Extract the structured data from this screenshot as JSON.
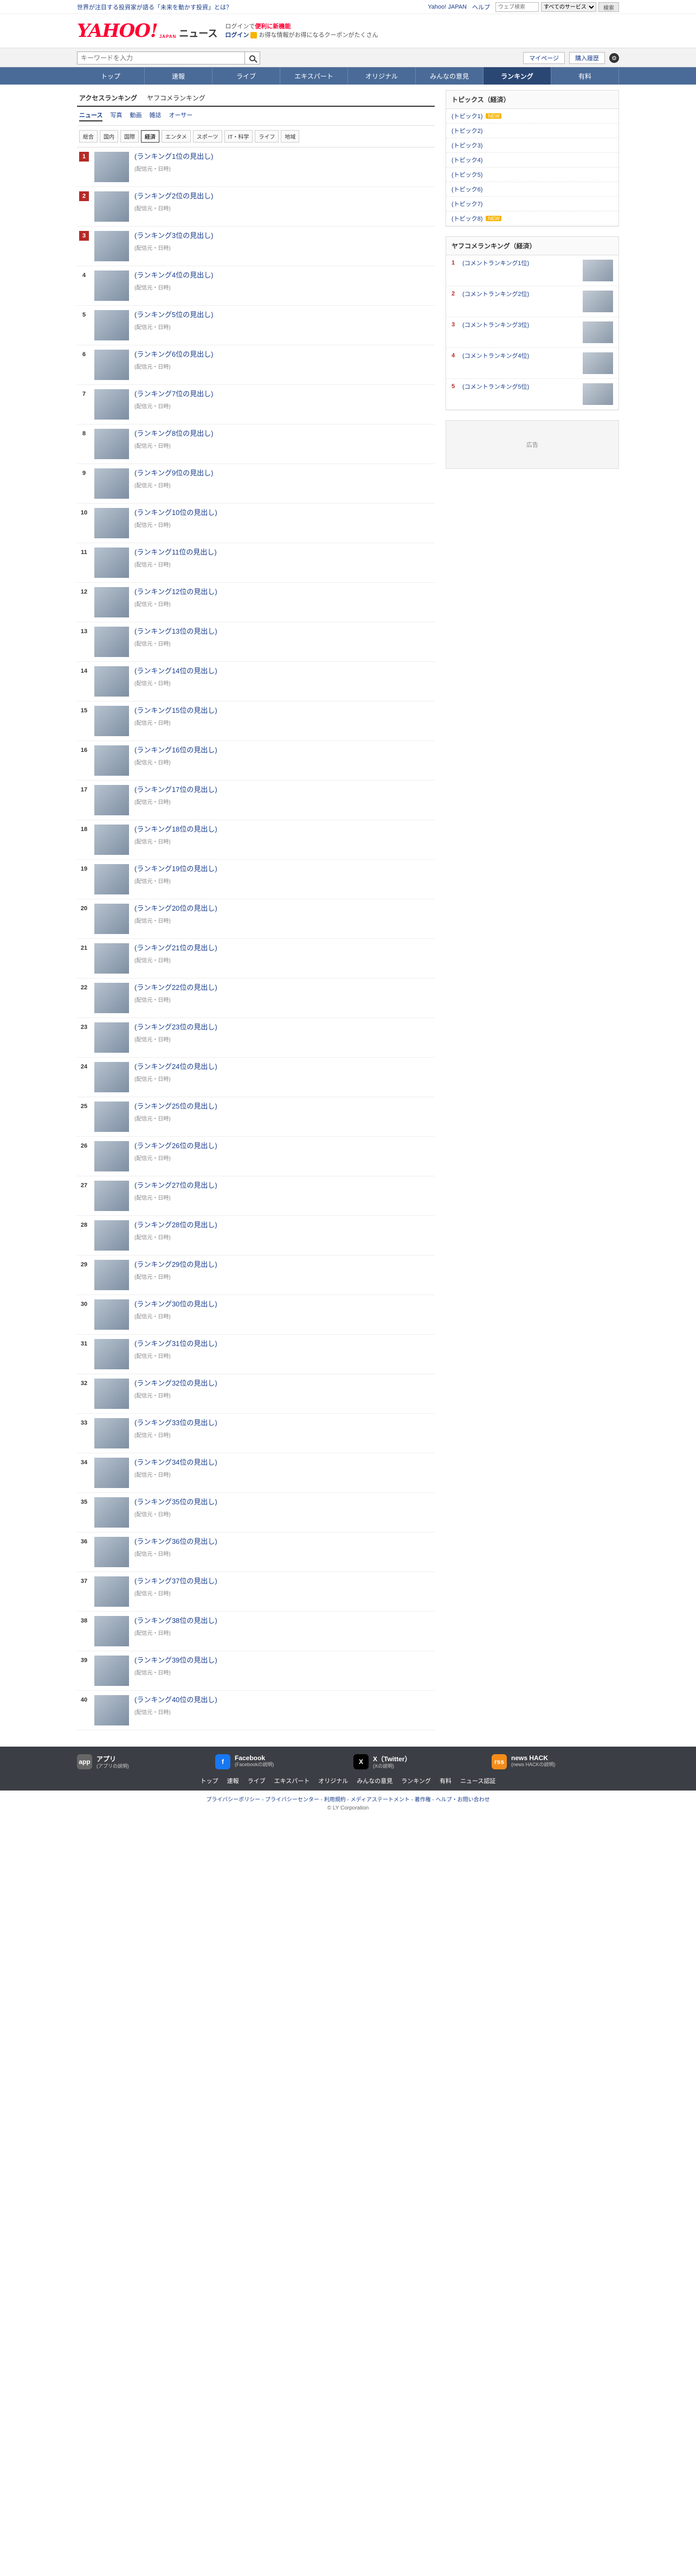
{
  "promo": {
    "left": "世界が注目する投資家が語る「未来を動かす投資」とは？",
    "yahoo_link": "Yahoo! JAPAN",
    "help_link": "ヘルプ",
    "search_placeholder": "ウェブ検索",
    "search_scope": "すべてのサービス",
    "search_button": "検索"
  },
  "brand": {
    "logo_yahoo": "YAHOO!",
    "logo_japan": "JAPAN",
    "logo_news": "ニュース",
    "tagline_prefix": "ログインで",
    "tagline_highlight": "便利に新機能",
    "login": "ログイン",
    "coupon_text": "お得な情報がお得になるクーポンがたくさん"
  },
  "searchbar": {
    "placeholder": "キーワードを入力",
    "mypage": "マイページ",
    "subscribe": "購入履歴"
  },
  "gnav": [
    {
      "label": "トップ"
    },
    {
      "label": "速報"
    },
    {
      "label": "ライブ"
    },
    {
      "label": "エキスパート"
    },
    {
      "label": "オリジナル"
    },
    {
      "label": "みんなの意見"
    },
    {
      "label": "ランキング",
      "active": true
    },
    {
      "label": "有料"
    }
  ],
  "subtabs": [
    {
      "label": "アクセスランキング",
      "on": true
    },
    {
      "label": "ヤフコメランキング"
    }
  ],
  "kindtabs": [
    {
      "label": "ニュース",
      "on": true
    },
    {
      "label": "写真"
    },
    {
      "label": "動画"
    },
    {
      "label": "雑誌"
    },
    {
      "label": "オーサー"
    }
  ],
  "cattabs": [
    {
      "label": "総合"
    },
    {
      "label": "国内"
    },
    {
      "label": "国際"
    },
    {
      "label": "経済",
      "on": true
    },
    {
      "label": "エンタメ"
    },
    {
      "label": "スポーツ"
    },
    {
      "label": "IT・科学"
    },
    {
      "label": "ライフ"
    },
    {
      "label": "地域"
    }
  ],
  "ranking": [
    {
      "no": "1",
      "title": "(ランキング1位の見出し)",
      "meta": "(配信元・日時)"
    },
    {
      "no": "2",
      "title": "(ランキング2位の見出し)",
      "meta": "(配信元・日時)"
    },
    {
      "no": "3",
      "title": "(ランキング3位の見出し)",
      "meta": "(配信元・日時)"
    },
    {
      "no": "4",
      "title": "(ランキング4位の見出し)",
      "meta": "(配信元・日時)"
    },
    {
      "no": "5",
      "title": "(ランキング5位の見出し)",
      "meta": "(配信元・日時)"
    },
    {
      "no": "6",
      "title": "(ランキング6位の見出し)",
      "meta": "(配信元・日時)"
    },
    {
      "no": "7",
      "title": "(ランキング7位の見出し)",
      "meta": "(配信元・日時)"
    },
    {
      "no": "8",
      "title": "(ランキング8位の見出し)",
      "meta": "(配信元・日時)"
    },
    {
      "no": "9",
      "title": "(ランキング9位の見出し)",
      "meta": "(配信元・日時)"
    },
    {
      "no": "10",
      "title": "(ランキング10位の見出し)",
      "meta": "(配信元・日時)"
    },
    {
      "no": "11",
      "title": "(ランキング11位の見出し)",
      "meta": "(配信元・日時)"
    },
    {
      "no": "12",
      "title": "(ランキング12位の見出し)",
      "meta": "(配信元・日時)"
    },
    {
      "no": "13",
      "title": "(ランキング13位の見出し)",
      "meta": "(配信元・日時)"
    },
    {
      "no": "14",
      "title": "(ランキング14位の見出し)",
      "meta": "(配信元・日時)"
    },
    {
      "no": "15",
      "title": "(ランキング15位の見出し)",
      "meta": "(配信元・日時)"
    },
    {
      "no": "16",
      "title": "(ランキング16位の見出し)",
      "meta": "(配信元・日時)"
    },
    {
      "no": "17",
      "title": "(ランキング17位の見出し)",
      "meta": "(配信元・日時)"
    },
    {
      "no": "18",
      "title": "(ランキング18位の見出し)",
      "meta": "(配信元・日時)"
    },
    {
      "no": "19",
      "title": "(ランキング19位の見出し)",
      "meta": "(配信元・日時)"
    },
    {
      "no": "20",
      "title": "(ランキング20位の見出し)",
      "meta": "(配信元・日時)"
    },
    {
      "no": "21",
      "title": "(ランキング21位の見出し)",
      "meta": "(配信元・日時)"
    },
    {
      "no": "22",
      "title": "(ランキング22位の見出し)",
      "meta": "(配信元・日時)"
    },
    {
      "no": "23",
      "title": "(ランキング23位の見出し)",
      "meta": "(配信元・日時)"
    },
    {
      "no": "24",
      "title": "(ランキング24位の見出し)",
      "meta": "(配信元・日時)"
    },
    {
      "no": "25",
      "title": "(ランキング25位の見出し)",
      "meta": "(配信元・日時)"
    },
    {
      "no": "26",
      "title": "(ランキング26位の見出し)",
      "meta": "(配信元・日時)"
    },
    {
      "no": "27",
      "title": "(ランキング27位の見出し)",
      "meta": "(配信元・日時)"
    },
    {
      "no": "28",
      "title": "(ランキング28位の見出し)",
      "meta": "(配信元・日時)"
    },
    {
      "no": "29",
      "title": "(ランキング29位の見出し)",
      "meta": "(配信元・日時)"
    },
    {
      "no": "30",
      "title": "(ランキング30位の見出し)",
      "meta": "(配信元・日時)"
    },
    {
      "no": "31",
      "title": "(ランキング31位の見出し)",
      "meta": "(配信元・日時)"
    },
    {
      "no": "32",
      "title": "(ランキング32位の見出し)",
      "meta": "(配信元・日時)"
    },
    {
      "no": "33",
      "title": "(ランキング33位の見出し)",
      "meta": "(配信元・日時)"
    },
    {
      "no": "34",
      "title": "(ランキング34位の見出し)",
      "meta": "(配信元・日時)"
    },
    {
      "no": "35",
      "title": "(ランキング35位の見出し)",
      "meta": "(配信元・日時)"
    },
    {
      "no": "36",
      "title": "(ランキング36位の見出し)",
      "meta": "(配信元・日時)"
    },
    {
      "no": "37",
      "title": "(ランキング37位の見出し)",
      "meta": "(配信元・日時)"
    },
    {
      "no": "38",
      "title": "(ランキング38位の見出し)",
      "meta": "(配信元・日時)"
    },
    {
      "no": "39",
      "title": "(ランキング39位の見出し)",
      "meta": "(配信元・日時)"
    },
    {
      "no": "40",
      "title": "(ランキング40位の見出し)",
      "meta": "(配信元・日時)"
    }
  ],
  "side": {
    "topics_head": "トピックス（経済）",
    "topics": [
      {
        "label": "(トピック1)",
        "badge": "NEW"
      },
      {
        "label": "(トピック2)"
      },
      {
        "label": "(トピック3)"
      },
      {
        "label": "(トピック4)"
      },
      {
        "label": "(トピック5)"
      },
      {
        "label": "(トピック6)"
      },
      {
        "label": "(トピック7)"
      },
      {
        "label": "(トピック8)",
        "badge": "NEW"
      }
    ],
    "comment_head": "ヤフコメランキング（経済）",
    "comment_rank": [
      {
        "no": "1",
        "title": "(コメントランキング1位)"
      },
      {
        "no": "2",
        "title": "(コメントランキング2位)"
      },
      {
        "no": "3",
        "title": "(コメントランキング3位)"
      },
      {
        "no": "4",
        "title": "(コメントランキング4位)"
      },
      {
        "no": "5",
        "title": "(コメントランキング5位)"
      }
    ],
    "ad_label": "広告"
  },
  "footer": {
    "apps": [
      {
        "icon": "app",
        "name": "アプリ",
        "desc": "(アプリの説明)"
      },
      {
        "icon": "f",
        "name": "Facebook",
        "desc": "(Facebookの説明)"
      },
      {
        "icon": "X",
        "name": "X（Twitter）",
        "desc": "(Xの説明)"
      },
      {
        "icon": "rss",
        "name": "news HACK",
        "desc": "(news HACKの説明)"
      }
    ],
    "nav": [
      "トップ",
      "速報",
      "ライブ",
      "エキスパート",
      "オリジナル",
      "みんなの意見",
      "ランキング",
      "有料",
      "ニュース認証"
    ],
    "links": "プライバシーポリシー - プライバシーセンター - 利用規約 - メディアステートメント - 著作権 - ヘルプ・お問い合わせ",
    "copyright": "© LY Corporation"
  },
  "colors": {
    "brand_red": "#ff0033",
    "nav_blue": "#4a6b98",
    "nav_active": "#2a4774",
    "rank_top": "#b52b27",
    "link": "#1a3e8c"
  }
}
